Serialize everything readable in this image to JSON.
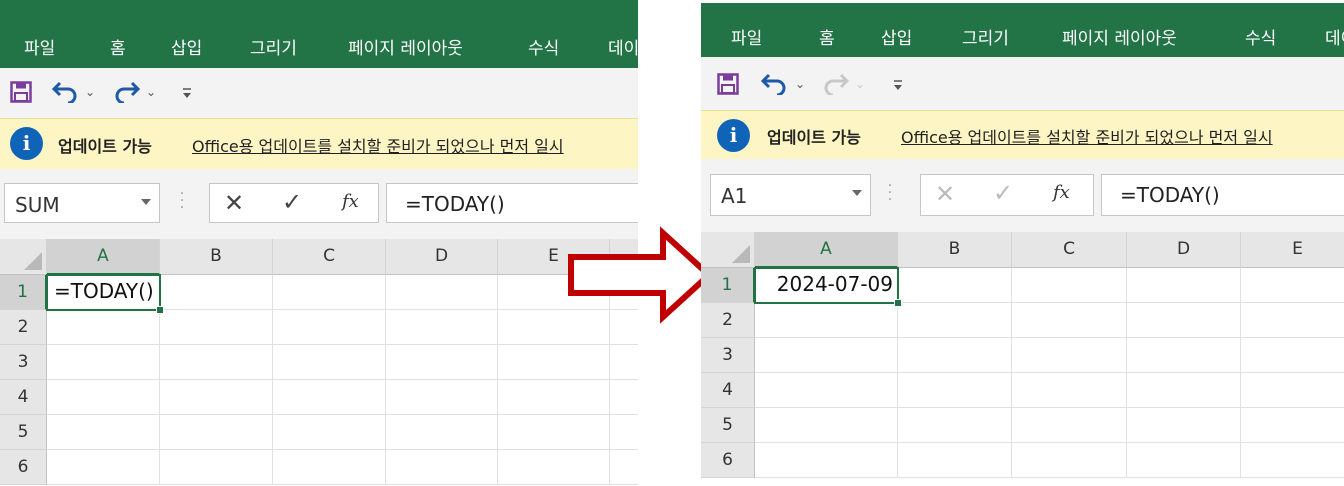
{
  "ribbon_tabs": [
    "파일",
    "홈",
    "삽입",
    "그리기",
    "페이지 레이아웃",
    "수식",
    "데이"
  ],
  "info_bar": {
    "title": "업데이트 가능",
    "message": "Office용 업데이트를 설치할 준비가 되었으나 먼저 일시"
  },
  "before": {
    "name_box": "SUM",
    "formula": "=TODAY()",
    "cell_content": "=TODAY()"
  },
  "after": {
    "name_box": "A1",
    "formula": "=TODAY()",
    "cell_content": "2024-07-09"
  },
  "columns": [
    "A",
    "B",
    "C",
    "D",
    "E"
  ],
  "rows": [
    "1",
    "2",
    "3",
    "4",
    "5",
    "6"
  ],
  "colors": {
    "ribbon": "#227447",
    "info_bar": "#fdf5c4",
    "selection": "#217346",
    "arrow": "#c00000"
  },
  "icons": {
    "save": "save-icon",
    "undo": "undo-icon",
    "redo": "redo-icon",
    "qat_menu": "customize-qat-icon",
    "info": "info-icon",
    "cancel": "cancel-icon",
    "enter": "check-icon",
    "function": "fx-icon",
    "transition": "right-arrow-icon"
  }
}
